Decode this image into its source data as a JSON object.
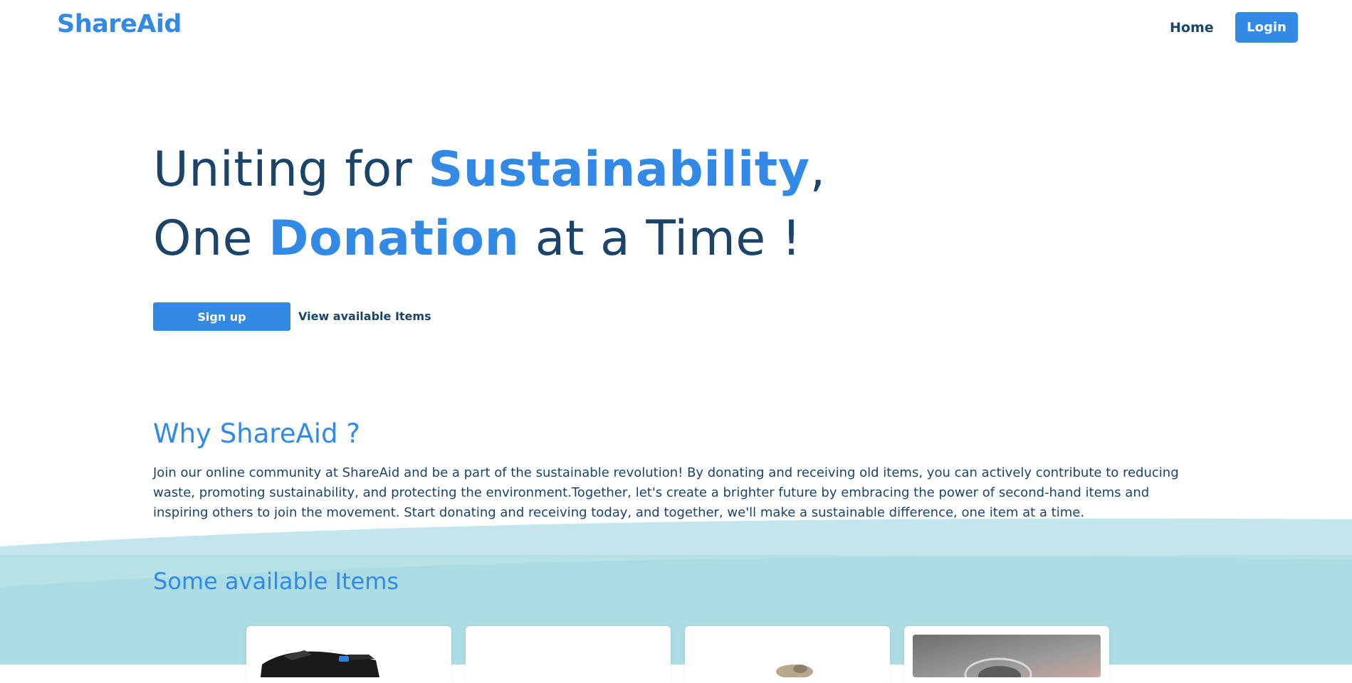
{
  "nav": {
    "logo": "ShareAid",
    "home": "Home",
    "login": "Login"
  },
  "hero": {
    "line1_start": "Uniting for ",
    "line1_highlight": "Sustainability",
    "line1_end": ",",
    "line2_start": "One ",
    "line2_highlight": "Donation",
    "line2_end": " at a Time !",
    "signup_label": "Sign up",
    "view_items_label": "View available Items"
  },
  "why": {
    "title": "Why ShareAid ?",
    "text": "Join our online community at ShareAid and be a part of the sustainable revolution! By donating and receiving old items, you can actively contribute to reducing waste, promoting sustainability, and protecting the environment.Together, let's create a brighter future by embracing the power of second-hand items and inspiring others to join the movement. Start donating and receiving today, and together, we'll make a sustainable difference, one item at a time."
  },
  "items": {
    "title": "Some available Items",
    "cards": [
      {
        "image": "black-shoes-photo"
      },
      {
        "image": "blank-photo"
      },
      {
        "image": "small-object-photo"
      },
      {
        "image": "grey-appliance-photo"
      }
    ]
  },
  "colors": {
    "primary": "#338ae6",
    "text_dark": "#1b4468",
    "wave_light": "#c2e6ec",
    "wave": "#acdde4"
  }
}
